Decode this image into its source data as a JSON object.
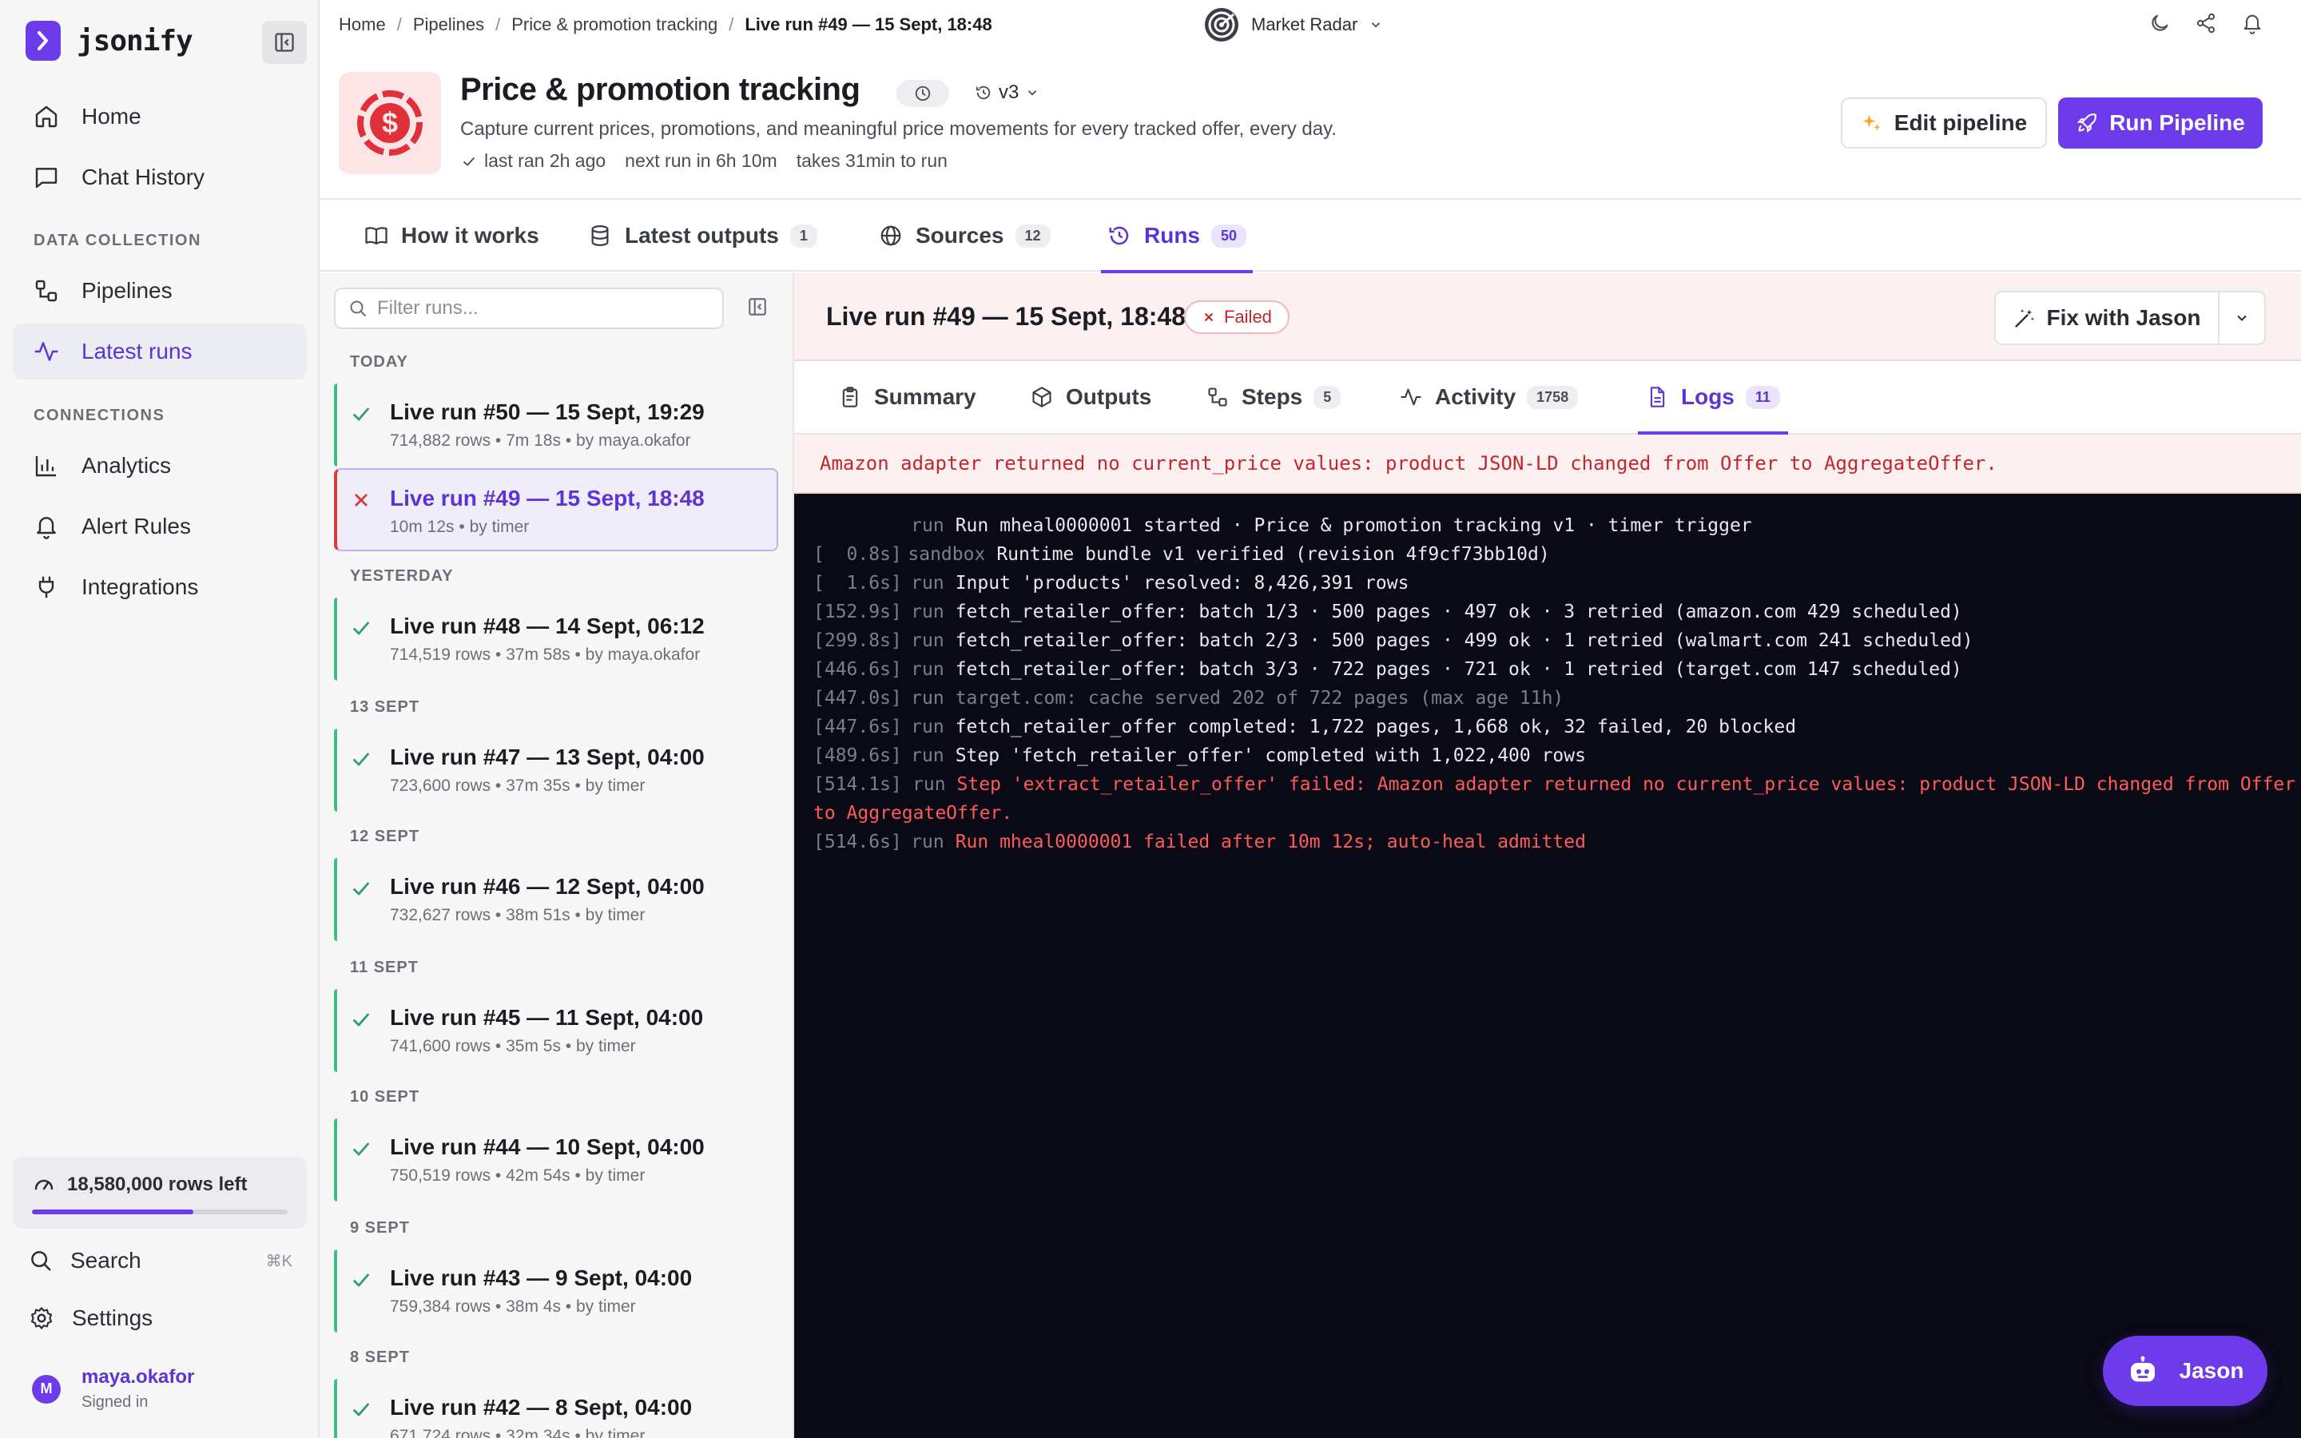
{
  "app": {
    "name": "jsonify"
  },
  "sidebar": {
    "nav_top": [
      {
        "label": "Home",
        "icon": "home-icon"
      },
      {
        "label": "Chat History",
        "icon": "chat-icon"
      }
    ],
    "section_data": "DATA COLLECTION",
    "nav_data": [
      {
        "label": "Pipelines",
        "icon": "pipelines-icon"
      },
      {
        "label": "Latest runs",
        "icon": "activity-icon",
        "active": true
      }
    ],
    "section_connections": "CONNECTIONS",
    "nav_connections": [
      {
        "label": "Analytics",
        "icon": "bar-chart-icon"
      },
      {
        "label": "Alert Rules",
        "icon": "bell-icon"
      },
      {
        "label": "Integrations",
        "icon": "plug-icon"
      }
    ],
    "rows_left": "18,580,000 rows left",
    "rows_progress": 0.63,
    "search_label": "Search",
    "search_shortcut": "⌘K",
    "settings_label": "Settings",
    "user": {
      "initial": "M",
      "name": "maya.okafor",
      "status": "Signed in"
    }
  },
  "breadcrumb": {
    "items": [
      "Home",
      "Pipelines",
      "Price & promotion tracking"
    ],
    "current": "Live run #49 — 15 Sept, 18:48"
  },
  "workspace": {
    "name": "Market Radar"
  },
  "pipeline": {
    "title": "Price & promotion tracking",
    "version": "v3",
    "description": "Capture current prices, promotions, and meaningful price movements for every tracked offer, every day.",
    "last_ran": "last ran 2h ago",
    "next_run": "next run in 6h 10m",
    "duration": "takes 31min to run",
    "edit_label": "Edit pipeline",
    "run_label": "Run Pipeline"
  },
  "main_tabs": [
    {
      "label": "How it works",
      "count": ""
    },
    {
      "label": "Latest outputs",
      "count": "1"
    },
    {
      "label": "Sources",
      "count": "12"
    },
    {
      "label": "Runs",
      "count": "50",
      "active": true
    }
  ],
  "runs": {
    "filter_placeholder": "Filter runs...",
    "groups": [
      {
        "label": "TODAY",
        "items": [
          {
            "title": "Live run #50 — 15 Sept, 19:29",
            "sub": "714,882 rows • 7m 18s • by maya.okafor",
            "status": "success"
          },
          {
            "title": "Live run #49 — 15 Sept, 18:48",
            "sub": "10m 12s • by timer",
            "status": "failed",
            "selected": true
          }
        ]
      },
      {
        "label": "YESTERDAY",
        "items": [
          {
            "title": "Live run #48 — 14 Sept, 06:12",
            "sub": "714,519 rows • 37m 58s • by maya.okafor",
            "status": "success"
          }
        ]
      },
      {
        "label": "13 SEPT",
        "items": [
          {
            "title": "Live run #47 — 13 Sept, 04:00",
            "sub": "723,600 rows • 37m 35s • by timer",
            "status": "success"
          }
        ]
      },
      {
        "label": "12 SEPT",
        "items": [
          {
            "title": "Live run #46 — 12 Sept, 04:00",
            "sub": "732,627 rows • 38m 51s • by timer",
            "status": "success"
          }
        ]
      },
      {
        "label": "11 SEPT",
        "items": [
          {
            "title": "Live run #45 — 11 Sept, 04:00",
            "sub": "741,600 rows • 35m 5s • by timer",
            "status": "success"
          }
        ]
      },
      {
        "label": "10 SEPT",
        "items": [
          {
            "title": "Live run #44 — 10 Sept, 04:00",
            "sub": "750,519 rows • 42m 54s • by timer",
            "status": "success"
          }
        ]
      },
      {
        "label": "9 SEPT",
        "items": [
          {
            "title": "Live run #43 — 9 Sept, 04:00",
            "sub": "759,384 rows • 38m 4s • by timer",
            "status": "success"
          }
        ]
      },
      {
        "label": "8 SEPT",
        "items": [
          {
            "title": "Live run #42 — 8 Sept, 04:00",
            "sub": "671,724 rows • 32m 34s • by timer",
            "status": "success"
          }
        ]
      }
    ]
  },
  "detail": {
    "title": "Live run #49 — 15 Sept, 18:48",
    "status": "Failed",
    "fix_label": "Fix with Jason",
    "tabs": [
      {
        "label": "Summary",
        "count": ""
      },
      {
        "label": "Outputs",
        "count": ""
      },
      {
        "label": "Steps",
        "count": "5"
      },
      {
        "label": "Activity",
        "count": "1758"
      },
      {
        "label": "Logs",
        "count": "11",
        "active": true
      }
    ],
    "error": "Amazon adapter returned no current_price values: product JSON-LD changed from Offer to AggregateOffer.",
    "logs": [
      {
        "t": "",
        "src": "run",
        "msg": "Run mheal0000001 started · Price & promotion tracking v1 · timer trigger",
        "kind": "normal"
      },
      {
        "t": "[  0.8s]",
        "src": "sandbox",
        "msg": "Runtime bundle v1 verified (revision 4f9cf73bb10d)",
        "kind": "normal"
      },
      {
        "t": "[  1.6s]",
        "src": "run",
        "msg": "Input 'products' resolved: 8,426,391 rows",
        "kind": "normal"
      },
      {
        "t": "[152.9s]",
        "src": "run",
        "msg": "fetch_retailer_offer: batch 1/3 · 500 pages · 497 ok · 3 retried (amazon.com 429 scheduled)",
        "kind": "normal"
      },
      {
        "t": "[299.8s]",
        "src": "run",
        "msg": "fetch_retailer_offer: batch 2/3 · 500 pages · 499 ok · 1 retried (walmart.com 241 scheduled)",
        "kind": "normal"
      },
      {
        "t": "[446.6s]",
        "src": "run",
        "msg": "fetch_retailer_offer: batch 3/3 · 722 pages · 721 ok · 1 retried (target.com 147 scheduled)",
        "kind": "normal"
      },
      {
        "t": "[447.0s]",
        "src": "run",
        "msg": "target.com: cache served 202 of 722 pages (max age 11h)",
        "kind": "muted"
      },
      {
        "t": "[447.6s]",
        "src": "run",
        "msg": "fetch_retailer_offer completed: 1,722 pages, 1,668 ok, 32 failed, 20 blocked",
        "kind": "normal"
      },
      {
        "t": "[489.6s]",
        "src": "run",
        "msg": "Step 'fetch_retailer_offer' completed with 1,022,400 rows",
        "kind": "normal"
      },
      {
        "t": "[514.1s]",
        "src": "run",
        "msg": "Step 'extract_retailer_offer' failed: Amazon adapter returned no current_price values: product JSON-LD changed from Offer to AggregateOffer.",
        "kind": "err",
        "wrap": true
      },
      {
        "t": "[514.6s]",
        "src": "run",
        "msg": "Run mheal0000001 failed after 10m 12s; auto-heal admitted",
        "kind": "err"
      }
    ]
  },
  "assistant": {
    "label": "Jason"
  },
  "colors": {
    "accent": "#6d3bea",
    "success": "#3fbf7f",
    "danger": "#d93a3a",
    "log_bg": "#0a0a16"
  }
}
